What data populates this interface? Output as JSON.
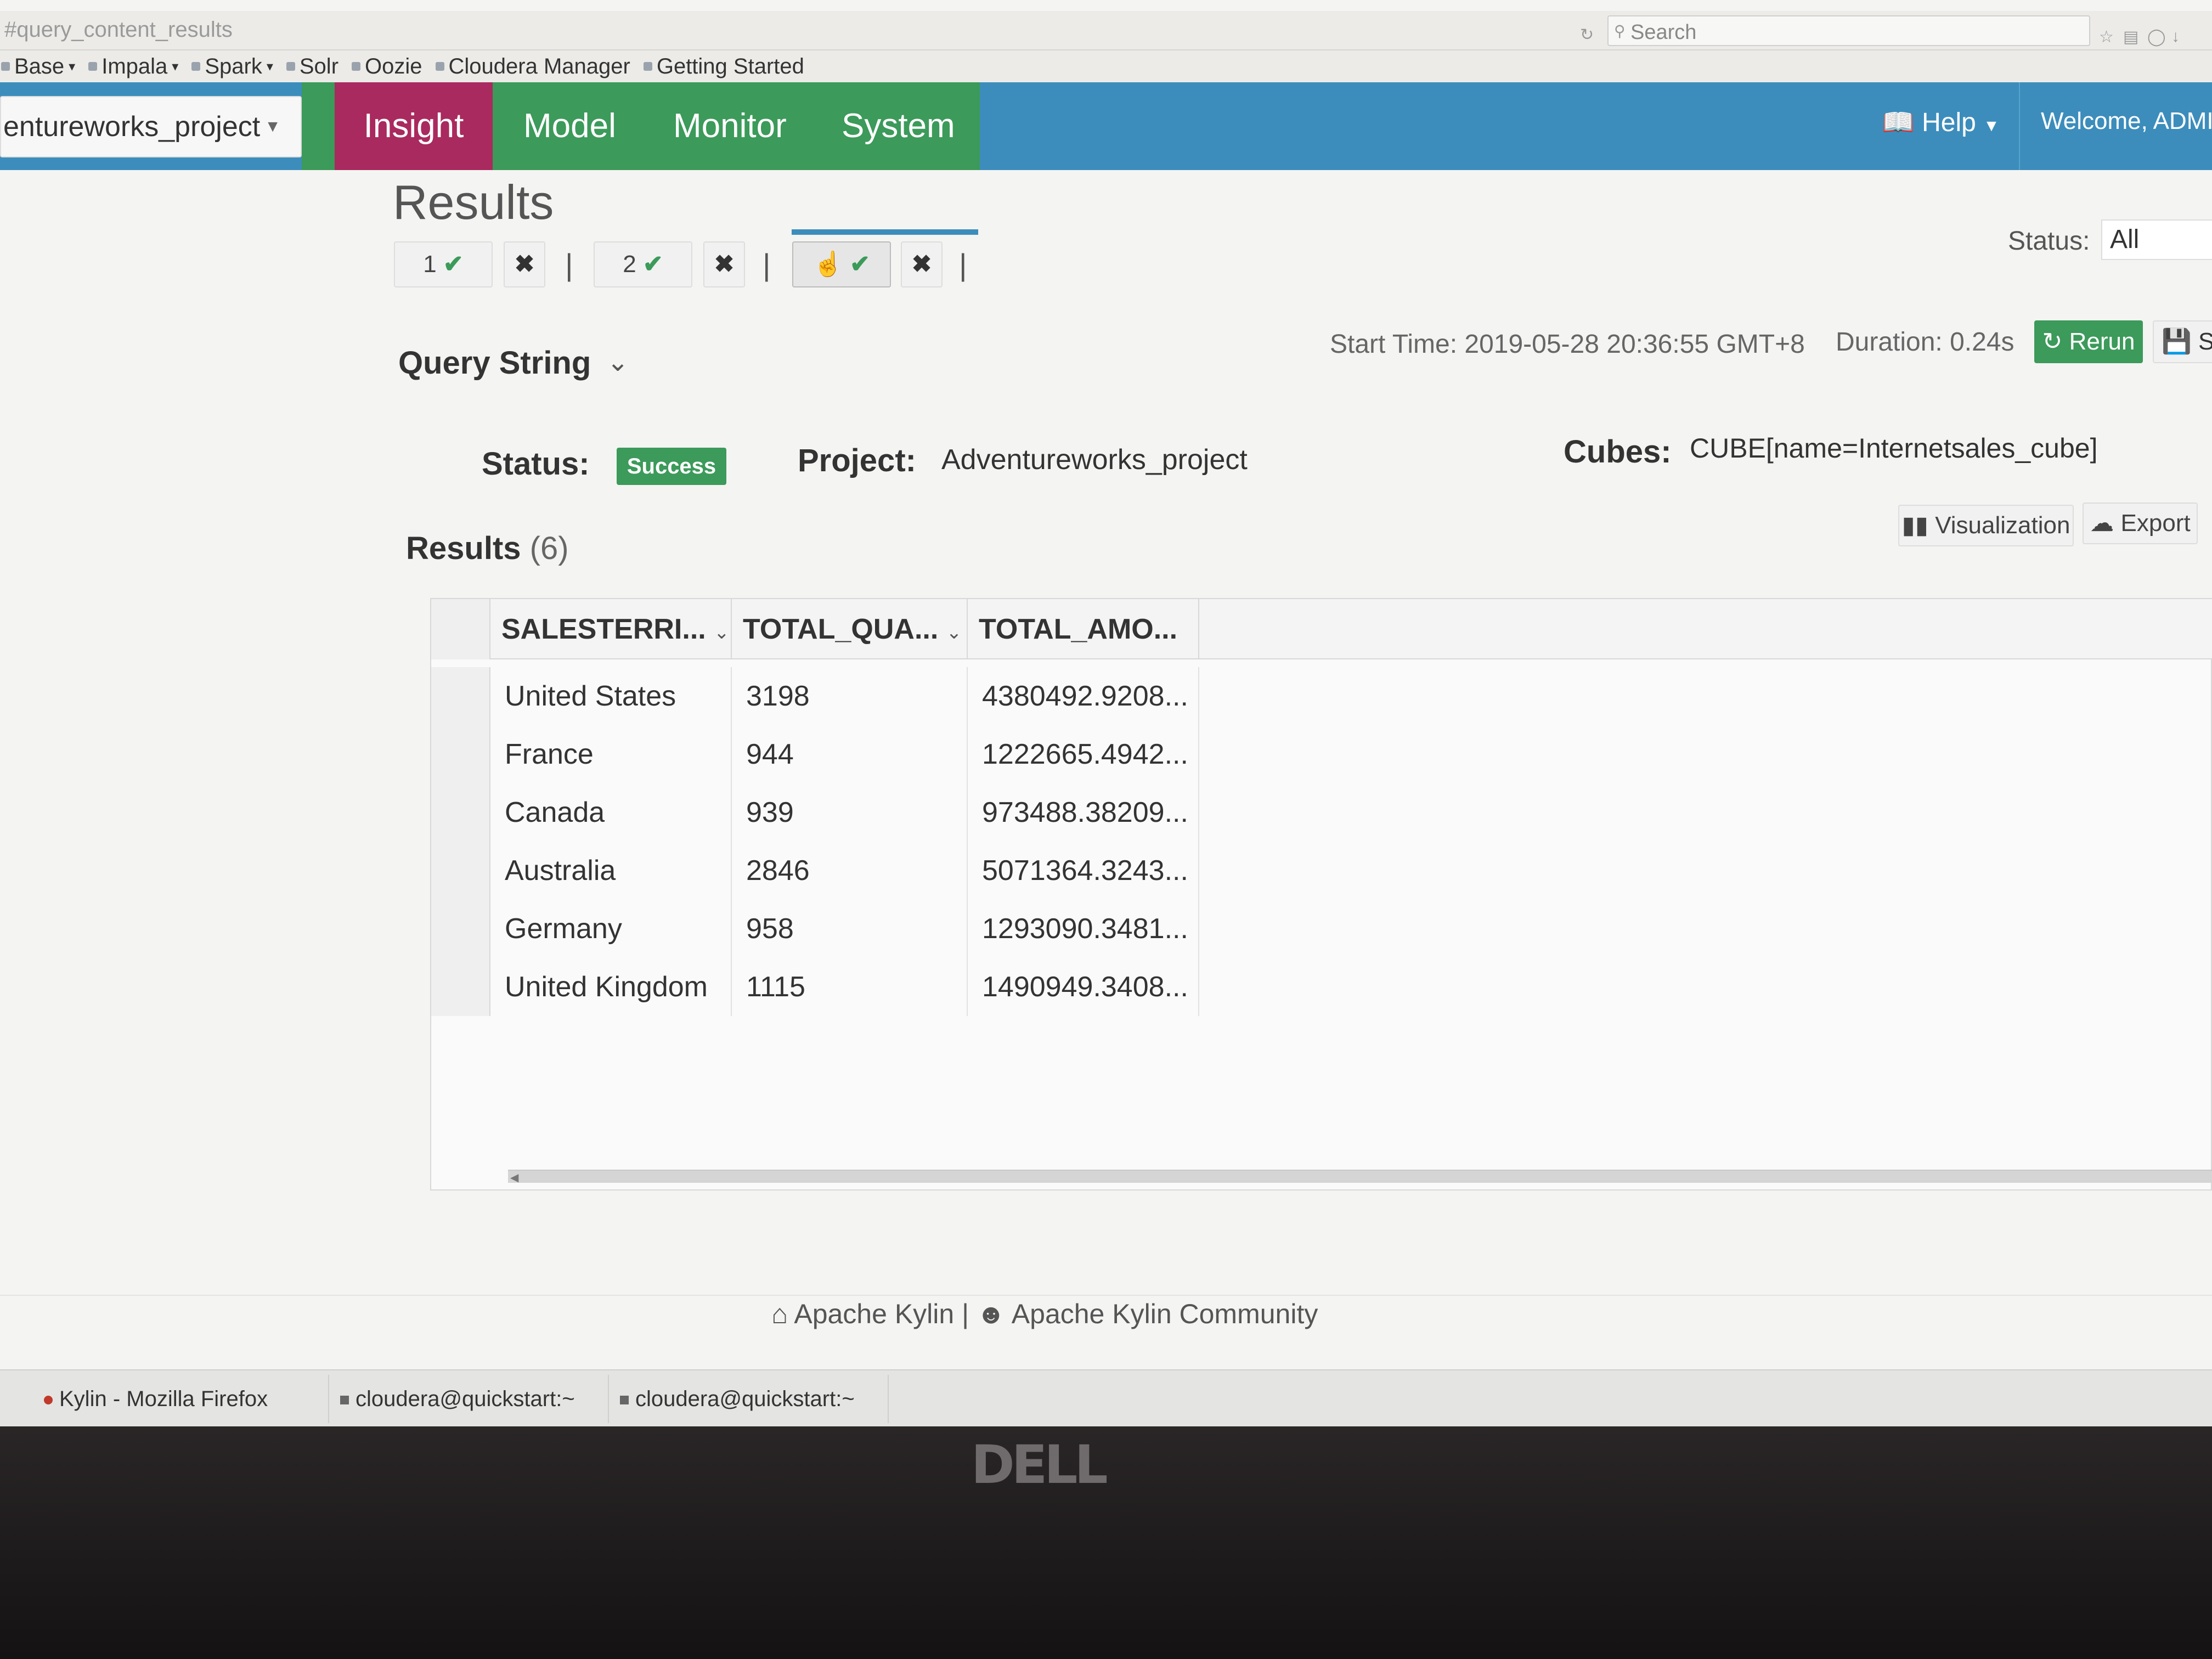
{
  "browser": {
    "url": "#query_content_results",
    "search_placeholder": "Search",
    "bookmarks": [
      {
        "label": "Base",
        "has_menu": true
      },
      {
        "label": "Impala",
        "has_menu": true
      },
      {
        "label": "Spark",
        "has_menu": true
      },
      {
        "label": "Solr",
        "has_menu": false
      },
      {
        "label": "Oozie",
        "has_menu": false
      },
      {
        "label": "Cloudera Manager",
        "has_menu": false
      },
      {
        "label": "Getting Started",
        "has_menu": false
      }
    ]
  },
  "navbar": {
    "project": "entureworks_project",
    "tabs": [
      "Insight",
      "Model",
      "Monitor",
      "System"
    ],
    "active_tab": "Insight",
    "help_label": "Help",
    "welcome": "Welcome, ADMIN"
  },
  "page": {
    "title": "Results",
    "query_tabs": [
      {
        "label": "1",
        "status": "success"
      },
      {
        "label": "2",
        "status": "success"
      },
      {
        "label": "",
        "status": "success",
        "active": true
      }
    ],
    "status_filter_label": "Status:",
    "status_filter_value": "All"
  },
  "query": {
    "section_title": "Query String",
    "start_time": "Start Time: 2019-05-28 20:36:55 GMT+8",
    "duration": "Duration: 0.24s",
    "rerun_label": "Rerun",
    "save_label": "Sa",
    "status_label": "Status:",
    "status_value": "Success",
    "project_label": "Project:",
    "project_value": "Adventureworks_project",
    "cubes_label": "Cubes:",
    "cubes_value": "CUBE[name=Internetsales_cube]"
  },
  "results": {
    "title": "Results",
    "count": "(6)",
    "visualization_label": "Visualization",
    "export_label": "Export",
    "columns": [
      "SALESTERRI...",
      "TOTAL_QUA...",
      "TOTAL_AMO..."
    ],
    "rows": [
      [
        "United States",
        "3198",
        "4380492.9208..."
      ],
      [
        "France",
        "944",
        "1222665.4942..."
      ],
      [
        "Canada",
        "939",
        "973488.38209..."
      ],
      [
        "Australia",
        "2846",
        "5071364.3243..."
      ],
      [
        "Germany",
        "958",
        "1293090.3481..."
      ],
      [
        "United Kingdom",
        "1115",
        "1490949.3408..."
      ]
    ]
  },
  "footer": {
    "left_link": "Apache Kylin",
    "separator": "|",
    "right_link": "Apache Kylin Community"
  },
  "taskbar": {
    "items": [
      "Kylin - Mozilla Firefox",
      "cloudera@quickstart:~",
      "cloudera@quickstart:~"
    ]
  },
  "device": {
    "brand": "DELL"
  },
  "colors": {
    "navbar_blue": "#3c8dbc",
    "nav_green": "#3c9a5a",
    "insight_active": "#a92a5e",
    "success_green": "#3c9a5a"
  }
}
